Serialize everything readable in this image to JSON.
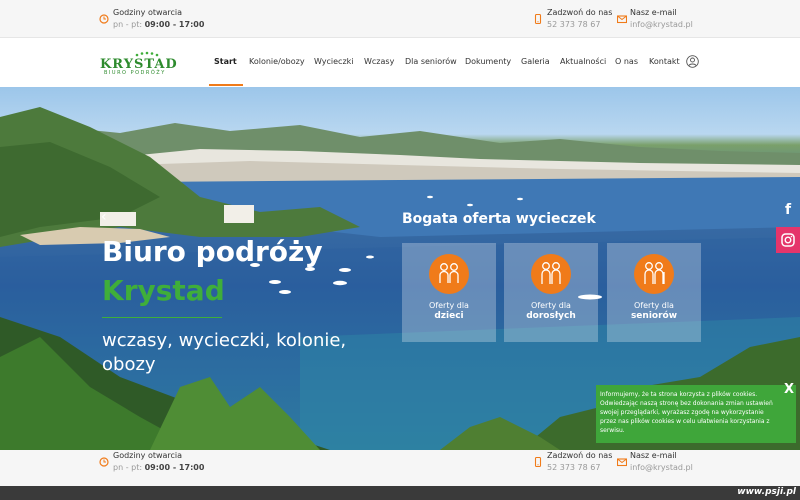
{
  "topbar": {
    "hours_label": "Godziny otwarcia",
    "hours_days": "pn - pt:",
    "hours_time": "09:00 - 17:00",
    "phone_label": "Zadzwoń do nas",
    "phone_value": "52 373 78 67",
    "email_label": "Nasz e-mail",
    "email_value": "info@krystad.pl"
  },
  "logo": {
    "main": "KRYSTAD",
    "sub": "BIURO PODRÓŻY"
  },
  "nav": {
    "items": [
      "Start",
      "Kolonie/obozy",
      "Wycieczki",
      "Wczasy",
      "Dla seniorów",
      "Dokumenty",
      "Galeria",
      "Aktualności",
      "O nas",
      "Kontakt"
    ]
  },
  "hero": {
    "title": "Biuro podróży",
    "title2": "Krystad",
    "subtitle": "wczasy, wycieczki, kolonie, obozy"
  },
  "offers": {
    "title": "Bogata oferta wycieczek",
    "cards": [
      {
        "line1": "Oferty dla",
        "line2": "dzieci",
        "icon": "children-icon"
      },
      {
        "line1": "Oferty dla",
        "line2": "dorosłych",
        "icon": "adults-icon"
      },
      {
        "line1": "Oferty dla",
        "line2": "seniorów",
        "icon": "seniors-icon"
      }
    ]
  },
  "cookie": {
    "text": "Informujemy, że ta strona korzysta z plików cookies. Odwiedzając naszą stronę bez dokonania zmian ustawień swojej przeglądarki, wyrażasz zgodę na wykorzystanie przez nas plików cookies w celu ułatwienia korzystania z serwisu.",
    "close": "X"
  },
  "watermark": "www.psji.pl",
  "colors": {
    "accent": "#f07b1a",
    "brand_green": "#3fae3a",
    "instagram": "#e5356b"
  }
}
